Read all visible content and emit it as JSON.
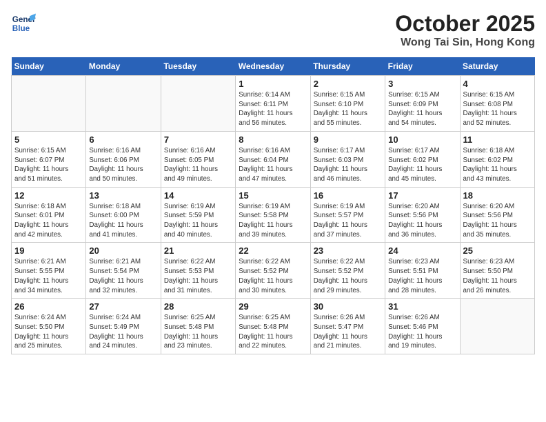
{
  "header": {
    "logo_line1": "General",
    "logo_line2": "Blue",
    "month": "October 2025",
    "location": "Wong Tai Sin, Hong Kong"
  },
  "weekdays": [
    "Sunday",
    "Monday",
    "Tuesday",
    "Wednesday",
    "Thursday",
    "Friday",
    "Saturday"
  ],
  "weeks": [
    [
      {
        "day": "",
        "info": ""
      },
      {
        "day": "",
        "info": ""
      },
      {
        "day": "",
        "info": ""
      },
      {
        "day": "1",
        "info": "Sunrise: 6:14 AM\nSunset: 6:11 PM\nDaylight: 11 hours\nand 56 minutes."
      },
      {
        "day": "2",
        "info": "Sunrise: 6:15 AM\nSunset: 6:10 PM\nDaylight: 11 hours\nand 55 minutes."
      },
      {
        "day": "3",
        "info": "Sunrise: 6:15 AM\nSunset: 6:09 PM\nDaylight: 11 hours\nand 54 minutes."
      },
      {
        "day": "4",
        "info": "Sunrise: 6:15 AM\nSunset: 6:08 PM\nDaylight: 11 hours\nand 52 minutes."
      }
    ],
    [
      {
        "day": "5",
        "info": "Sunrise: 6:15 AM\nSunset: 6:07 PM\nDaylight: 11 hours\nand 51 minutes."
      },
      {
        "day": "6",
        "info": "Sunrise: 6:16 AM\nSunset: 6:06 PM\nDaylight: 11 hours\nand 50 minutes."
      },
      {
        "day": "7",
        "info": "Sunrise: 6:16 AM\nSunset: 6:05 PM\nDaylight: 11 hours\nand 49 minutes."
      },
      {
        "day": "8",
        "info": "Sunrise: 6:16 AM\nSunset: 6:04 PM\nDaylight: 11 hours\nand 47 minutes."
      },
      {
        "day": "9",
        "info": "Sunrise: 6:17 AM\nSunset: 6:03 PM\nDaylight: 11 hours\nand 46 minutes."
      },
      {
        "day": "10",
        "info": "Sunrise: 6:17 AM\nSunset: 6:02 PM\nDaylight: 11 hours\nand 45 minutes."
      },
      {
        "day": "11",
        "info": "Sunrise: 6:18 AM\nSunset: 6:02 PM\nDaylight: 11 hours\nand 43 minutes."
      }
    ],
    [
      {
        "day": "12",
        "info": "Sunrise: 6:18 AM\nSunset: 6:01 PM\nDaylight: 11 hours\nand 42 minutes."
      },
      {
        "day": "13",
        "info": "Sunrise: 6:18 AM\nSunset: 6:00 PM\nDaylight: 11 hours\nand 41 minutes."
      },
      {
        "day": "14",
        "info": "Sunrise: 6:19 AM\nSunset: 5:59 PM\nDaylight: 11 hours\nand 40 minutes."
      },
      {
        "day": "15",
        "info": "Sunrise: 6:19 AM\nSunset: 5:58 PM\nDaylight: 11 hours\nand 39 minutes."
      },
      {
        "day": "16",
        "info": "Sunrise: 6:19 AM\nSunset: 5:57 PM\nDaylight: 11 hours\nand 37 minutes."
      },
      {
        "day": "17",
        "info": "Sunrise: 6:20 AM\nSunset: 5:56 PM\nDaylight: 11 hours\nand 36 minutes."
      },
      {
        "day": "18",
        "info": "Sunrise: 6:20 AM\nSunset: 5:56 PM\nDaylight: 11 hours\nand 35 minutes."
      }
    ],
    [
      {
        "day": "19",
        "info": "Sunrise: 6:21 AM\nSunset: 5:55 PM\nDaylight: 11 hours\nand 34 minutes."
      },
      {
        "day": "20",
        "info": "Sunrise: 6:21 AM\nSunset: 5:54 PM\nDaylight: 11 hours\nand 32 minutes."
      },
      {
        "day": "21",
        "info": "Sunrise: 6:22 AM\nSunset: 5:53 PM\nDaylight: 11 hours\nand 31 minutes."
      },
      {
        "day": "22",
        "info": "Sunrise: 6:22 AM\nSunset: 5:52 PM\nDaylight: 11 hours\nand 30 minutes."
      },
      {
        "day": "23",
        "info": "Sunrise: 6:22 AM\nSunset: 5:52 PM\nDaylight: 11 hours\nand 29 minutes."
      },
      {
        "day": "24",
        "info": "Sunrise: 6:23 AM\nSunset: 5:51 PM\nDaylight: 11 hours\nand 28 minutes."
      },
      {
        "day": "25",
        "info": "Sunrise: 6:23 AM\nSunset: 5:50 PM\nDaylight: 11 hours\nand 26 minutes."
      }
    ],
    [
      {
        "day": "26",
        "info": "Sunrise: 6:24 AM\nSunset: 5:50 PM\nDaylight: 11 hours\nand 25 minutes."
      },
      {
        "day": "27",
        "info": "Sunrise: 6:24 AM\nSunset: 5:49 PM\nDaylight: 11 hours\nand 24 minutes."
      },
      {
        "day": "28",
        "info": "Sunrise: 6:25 AM\nSunset: 5:48 PM\nDaylight: 11 hours\nand 23 minutes."
      },
      {
        "day": "29",
        "info": "Sunrise: 6:25 AM\nSunset: 5:48 PM\nDaylight: 11 hours\nand 22 minutes."
      },
      {
        "day": "30",
        "info": "Sunrise: 6:26 AM\nSunset: 5:47 PM\nDaylight: 11 hours\nand 21 minutes."
      },
      {
        "day": "31",
        "info": "Sunrise: 6:26 AM\nSunset: 5:46 PM\nDaylight: 11 hours\nand 19 minutes."
      },
      {
        "day": "",
        "info": ""
      }
    ]
  ]
}
